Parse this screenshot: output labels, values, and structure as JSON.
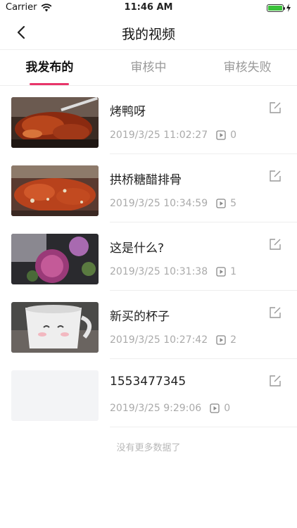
{
  "status": {
    "carrier": "Carrier",
    "time": "11:46 AM"
  },
  "nav": {
    "title": "我的视频"
  },
  "tabs": [
    {
      "label": "我发布的",
      "active": true
    },
    {
      "label": "审核中",
      "active": false
    },
    {
      "label": "审核失败",
      "active": false
    }
  ],
  "videos": [
    {
      "title": "烤鸭呀",
      "time": "2019/3/25 11:02:27",
      "plays": "0",
      "thumb": "food-roast-duck"
    },
    {
      "title": "拱桥糖醋排骨",
      "time": "2019/3/25 10:34:59",
      "plays": "5",
      "thumb": "food-sweet-sour-ribs"
    },
    {
      "title": "这是什么?",
      "time": "2019/3/25 10:31:38",
      "plays": "1",
      "thumb": "purple-flowers"
    },
    {
      "title": "新买的杯子",
      "time": "2019/3/25 10:27:42",
      "plays": "2",
      "thumb": "cup"
    },
    {
      "title": "1553477345",
      "time": "2019/3/25 9:29:06",
      "plays": "0",
      "thumb": "blank"
    }
  ],
  "footer": {
    "no_more": "没有更多数据了"
  },
  "colors": {
    "accent": "#e8356a",
    "battery": "#3ac23a"
  }
}
